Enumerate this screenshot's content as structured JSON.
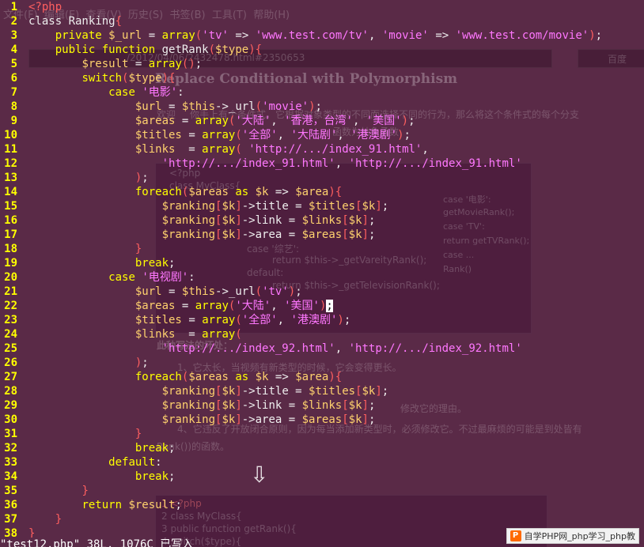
{
  "code_lines": [
    {
      "n": "1",
      "html": "<span class=\"b\">&lt;?php</span>"
    },
    {
      "n": "2",
      "html": "<span class=\"t\">class Ranking</span><span class=\"b\">{</span>"
    },
    {
      "n": "3",
      "html": "    <span class=\"k\">private</span> <span class=\"v\">$_url</span> <span class=\"t\">=</span> <span class=\"k\">array</span><span class=\"b\">(</span><span class=\"s\">'tv'</span> <span class=\"t\">=&gt;</span> <span class=\"s\">'www.test.com/tv'</span><span class=\"t\">,</span> <span class=\"s\">'movie'</span> <span class=\"t\">=&gt;</span> <span class=\"s\">'www.test.com/movie'</span><span class=\"b\">)</span><span class=\"t\">;</span>"
    },
    {
      "n": "4",
      "html": "    <span class=\"k\">public function</span> <span class=\"t\">getRank</span><span class=\"b\">(</span><span class=\"v\">$type</span><span class=\"b\">){</span>"
    },
    {
      "n": "5",
      "html": "        <span class=\"v\">$result</span> <span class=\"t\">=</span> <span class=\"k\">array</span><span class=\"b\">()</span><span class=\"t\">;</span>"
    },
    {
      "n": "6",
      "html": "        <span class=\"k\">switch</span><span class=\"b\">(</span><span class=\"v\">$type</span><span class=\"b\">){</span>"
    },
    {
      "n": "7",
      "html": "            <span class=\"k\">case</span> <span class=\"s\">'电影'</span><span class=\"t\">:</span>"
    },
    {
      "n": "8",
      "html": "                <span class=\"v\">$url</span> <span class=\"t\">=</span> <span class=\"v\">$this</span><span class=\"t\">-&gt;_url</span><span class=\"b\">(</span><span class=\"s\">'movie'</span><span class=\"b\">)</span><span class=\"t\">;</span>"
    },
    {
      "n": "9",
      "html": "                <span class=\"v\">$areas</span> <span class=\"t\">=</span> <span class=\"k\">array</span><span class=\"b\">(</span><span class=\"s\">'大陆'</span><span class=\"t\">,</span> <span class=\"s\">'香港，台湾'</span><span class=\"t\">,</span> <span class=\"s\">'美国'</span><span class=\"b\">)</span><span class=\"t\">;</span>"
    },
    {
      "n": "10",
      "html": "                <span class=\"v\">$titles</span> <span class=\"t\">=</span> <span class=\"k\">array</span><span class=\"b\">(</span><span class=\"s\">'全部'</span><span class=\"t\">,</span> <span class=\"s\">'大陆剧'</span><span class=\"t\">,</span> <span class=\"s\">'港澳剧'</span><span class=\"b\">)</span><span class=\"t\">;</span>"
    },
    {
      "n": "11",
      "html": "                <span class=\"v\">$links</span>  <span class=\"t\">=</span> <span class=\"k\">array</span><span class=\"b\">(</span> <span class=\"s\">'http://.../index_91.html'</span><span class=\"t\">,</span>"
    },
    {
      "n": "12",
      "html": "                    <span class=\"s\">'http://.../index_91.html'</span><span class=\"t\">,</span> <span class=\"s\">'http://.../index_91.html'</span>"
    },
    {
      "n": "13",
      "html": "                <span class=\"b\">)</span><span class=\"t\">;</span>"
    },
    {
      "n": "14",
      "html": "                <span class=\"k\">foreach</span><span class=\"b\">(</span><span class=\"v\">$areas</span> <span class=\"k\">as</span> <span class=\"v\">$k</span> <span class=\"t\">=&gt;</span> <span class=\"v\">$area</span><span class=\"b\">){</span>"
    },
    {
      "n": "15",
      "html": "                    <span class=\"v\">$ranking</span><span class=\"b\">[</span><span class=\"v\">$k</span><span class=\"b\">]</span><span class=\"t\">-&gt;title =</span> <span class=\"v\">$titles</span><span class=\"b\">[</span><span class=\"v\">$k</span><span class=\"b\">]</span><span class=\"t\">;</span>"
    },
    {
      "n": "16",
      "html": "                    <span class=\"v\">$ranking</span><span class=\"b\">[</span><span class=\"v\">$k</span><span class=\"b\">]</span><span class=\"t\">-&gt;link =</span> <span class=\"v\">$links</span><span class=\"b\">[</span><span class=\"v\">$k</span><span class=\"b\">]</span><span class=\"t\">;</span>"
    },
    {
      "n": "17",
      "html": "                    <span class=\"v\">$ranking</span><span class=\"b\">[</span><span class=\"v\">$k</span><span class=\"b\">]</span><span class=\"t\">-&gt;area =</span> <span class=\"v\">$areas</span><span class=\"b\">[</span><span class=\"v\">$k</span><span class=\"b\">]</span><span class=\"t\">;</span>"
    },
    {
      "n": "18",
      "html": "                <span class=\"b\">}</span>"
    },
    {
      "n": "19",
      "html": "                <span class=\"k\">break</span><span class=\"t\">;</span>"
    },
    {
      "n": "20",
      "html": "            <span class=\"k\">case</span> <span class=\"s\">'电视剧'</span><span class=\"t\">:</span>"
    },
    {
      "n": "21",
      "html": "                <span class=\"v\">$url</span> <span class=\"t\">=</span> <span class=\"v\">$this</span><span class=\"t\">-&gt;_url</span><span class=\"b\">(</span><span class=\"s\">'tv'</span><span class=\"b\">)</span><span class=\"t\">;</span>"
    },
    {
      "n": "22",
      "html": "                <span class=\"v\">$areas</span> <span class=\"t\">=</span> <span class=\"k\">array</span><span class=\"b\">(</span><span class=\"s\">'大陆'</span><span class=\"t\">,</span> <span class=\"s\">'美国'</span><span class=\"b\">)</span><span class=\"cursor\">;</span>"
    },
    {
      "n": "23",
      "html": "                <span class=\"v\">$titles</span> <span class=\"t\">=</span> <span class=\"k\">array</span><span class=\"b\">(</span><span class=\"s\">'全部'</span><span class=\"t\">,</span> <span class=\"s\">'港澳剧'</span><span class=\"b\">)</span><span class=\"t\">;</span>"
    },
    {
      "n": "24",
      "html": "                <span class=\"v\">$links</span>  <span class=\"t\">=</span> <span class=\"k\">array</span><span class=\"b\">(</span>"
    },
    {
      "n": "25",
      "html": "                    <span class=\"s\">'http://.../index_92.html'</span><span class=\"t\">,</span> <span class=\"s\">'http://.../index_92.html'</span>"
    },
    {
      "n": "26",
      "html": "                <span class=\"b\">)</span><span class=\"t\">;</span>"
    },
    {
      "n": "27",
      "html": "                <span class=\"k\">foreach</span><span class=\"b\">(</span><span class=\"v\">$areas</span> <span class=\"k\">as</span> <span class=\"v\">$k</span> <span class=\"t\">=&gt;</span> <span class=\"v\">$area</span><span class=\"b\">){</span>"
    },
    {
      "n": "28",
      "html": "                    <span class=\"v\">$ranking</span><span class=\"b\">[</span><span class=\"v\">$k</span><span class=\"b\">]</span><span class=\"t\">-&gt;title =</span> <span class=\"v\">$titles</span><span class=\"b\">[</span><span class=\"v\">$k</span><span class=\"b\">]</span><span class=\"t\">;</span>"
    },
    {
      "n": "29",
      "html": "                    <span class=\"v\">$ranking</span><span class=\"b\">[</span><span class=\"v\">$k</span><span class=\"b\">]</span><span class=\"t\">-&gt;link =</span> <span class=\"v\">$links</span><span class=\"b\">[</span><span class=\"v\">$k</span><span class=\"b\">]</span><span class=\"t\">;</span>"
    },
    {
      "n": "30",
      "html": "                    <span class=\"v\">$ranking</span><span class=\"b\">[</span><span class=\"v\">$k</span><span class=\"b\">]</span><span class=\"t\">-&gt;area =</span> <span class=\"v\">$areas</span><span class=\"b\">[</span><span class=\"v\">$k</span><span class=\"b\">]</span><span class=\"t\">;</span>"
    },
    {
      "n": "31",
      "html": "                <span class=\"b\">}</span>"
    },
    {
      "n": "32",
      "html": "                <span class=\"k\">break</span><span class=\"t\">;</span>"
    },
    {
      "n": "33",
      "html": "            <span class=\"k\">default</span><span class=\"t\">:</span>"
    },
    {
      "n": "34",
      "html": "                <span class=\"k\">break</span><span class=\"t\">;</span>"
    },
    {
      "n": "35",
      "html": "        <span class=\"b\">}</span>"
    },
    {
      "n": "36",
      "html": "        <span class=\"k\">return</span> <span class=\"v\">$result</span><span class=\"t\">;</span>"
    },
    {
      "n": "37",
      "html": "    <span class=\"b\">}</span>"
    },
    {
      "n": "38",
      "html": "<span class=\"b\">}</span>"
    }
  ],
  "status_line": "\"test12.php\" 38L, 1076C 已写入",
  "watermark": {
    "logo": "P",
    "text": "自学PHP网_php学习_php教"
  },
  "ghost": {
    "menu": [
      "文件(F)",
      "编辑(E)",
      "查看(V)",
      "历史(S)",
      "书签(B)",
      "工具(T)",
      "帮助(H)"
    ],
    "url": "/2012/04/06/2432478.html#2350653",
    "search_box": "百度",
    "heading": "Replace Conditional with Polymorphism",
    "intro": "你手上有个条件式，它根据对象类型的不同而选择不同的行为，那么将这个条件式的每个分支",
    "intro_prefix": "欢迎",
    "intro2": "函数为抽象函数",
    "box_lines": [
      "<?php",
      "class MyClass{",
      "    case '综艺':",
      "        return $this->_getVareityRank();",
      "    default:",
      "        return $this->_getTelevisionRank();"
    ],
    "side_lines": [
      "case '电影':",
      "getMovieRank();",
      "case 'TV':",
      "return getTVRank();",
      "case ...",
      "Rank()"
    ],
    "below_heading": "此种写法的坏处：",
    "below1": "1、它太长，当视频有新类型的时候，它会变得更长。",
    "below2": "修改它的理由。",
    "below3": "4、它违反了开放闭合原则，因为每当添加新类型时，必须修改它。不过最麻烦的可能是到处皆有",
    "below4": "Rank())的函数。",
    "arrow": "⇩",
    "box2_lines": [
      "1 <?php",
      "2 class MyClass{",
      "3     public function getRank(){",
      "4         switch($type){"
    ]
  }
}
